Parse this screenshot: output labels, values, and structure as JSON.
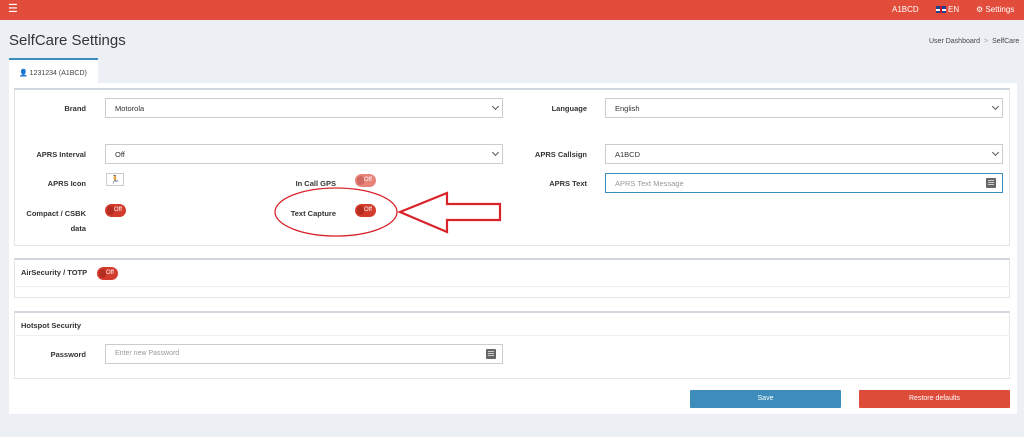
{
  "topbar": {
    "menu_icon": "hamburger-icon",
    "user": "A1BCD",
    "lang": "EN",
    "settings": "Settings"
  },
  "header": {
    "title": "SelfCare Settings",
    "breadcrumb": [
      "User Dashboard",
      "SelfCare"
    ]
  },
  "tab": {
    "label": "1231234 (A1BCD)"
  },
  "settings": {
    "brand": {
      "label": "Brand",
      "value": "Motorola"
    },
    "language": {
      "label": "Language",
      "value": "English"
    },
    "aprs_interval": {
      "label": "APRS Interval",
      "value": "Off"
    },
    "aprs_callsign": {
      "label": "APRS Callsign",
      "value": "A1BCD"
    },
    "aprs_icon": {
      "label": "APRS Icon",
      "value": "🏃"
    },
    "in_call_gps": {
      "label": "In Call GPS",
      "value": "Off"
    },
    "aprs_text": {
      "label": "APRS Text",
      "placeholder": "APRS Text Message"
    },
    "compact": {
      "label_line1": "Compact / CSBK",
      "label_line2": "data",
      "value": "Off"
    },
    "text_capture": {
      "label": "Text Capture",
      "value": "Off"
    }
  },
  "airsecurity": {
    "label": "AirSecurity / TOTP",
    "value": "Off"
  },
  "hotspot": {
    "title": "Hotspot Security",
    "password_label": "Password",
    "password_placeholder": "Enter new Password"
  },
  "buttons": {
    "save": "Save",
    "restore": "Restore defaults"
  },
  "colors": {
    "topbar": "#e14c3b",
    "save": "#3c8dbc",
    "restore": "#dd4b39",
    "annotation": "#d9232a"
  }
}
